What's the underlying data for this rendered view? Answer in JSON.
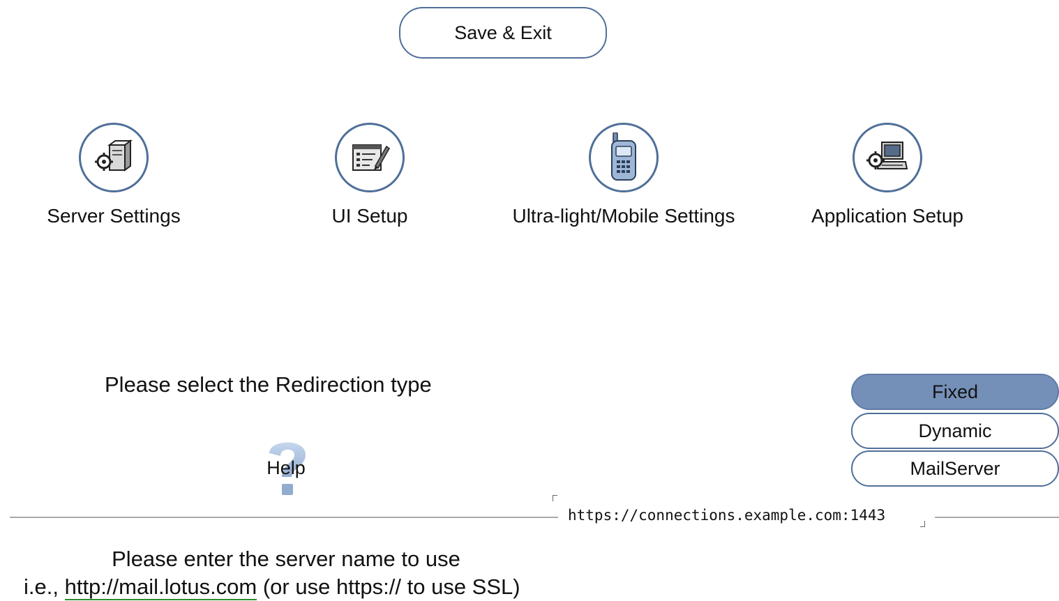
{
  "header": {
    "save_exit_label": "Save & Exit"
  },
  "nav": {
    "items": [
      {
        "label": "Server Settings",
        "icon": "server-gear-icon"
      },
      {
        "label": "UI Setup",
        "icon": "form-edit-icon"
      },
      {
        "label": "Ultra-light/Mobile Settings",
        "icon": "mobile-phone-icon"
      },
      {
        "label": "Application Setup",
        "icon": "computer-gear-icon"
      }
    ]
  },
  "redirection": {
    "prompt": "Please select the Redirection type",
    "help_label": "Help",
    "options": [
      {
        "label": "Fixed",
        "selected": true
      },
      {
        "label": "Dynamic",
        "selected": false
      },
      {
        "label": "MailServer",
        "selected": false
      }
    ]
  },
  "server": {
    "url_value": "https://connections.example.com:1443",
    "prompt": "Please enter the server name to use",
    "example_prefix": "i.e., ",
    "example_link": "http://mail.lotus.com",
    "example_suffix": " (or use https:// to use SSL)"
  },
  "colors": {
    "accent_border": "#4f6f99",
    "selected_fill": "#7590b8",
    "link_underline": "#2e8b2e"
  }
}
